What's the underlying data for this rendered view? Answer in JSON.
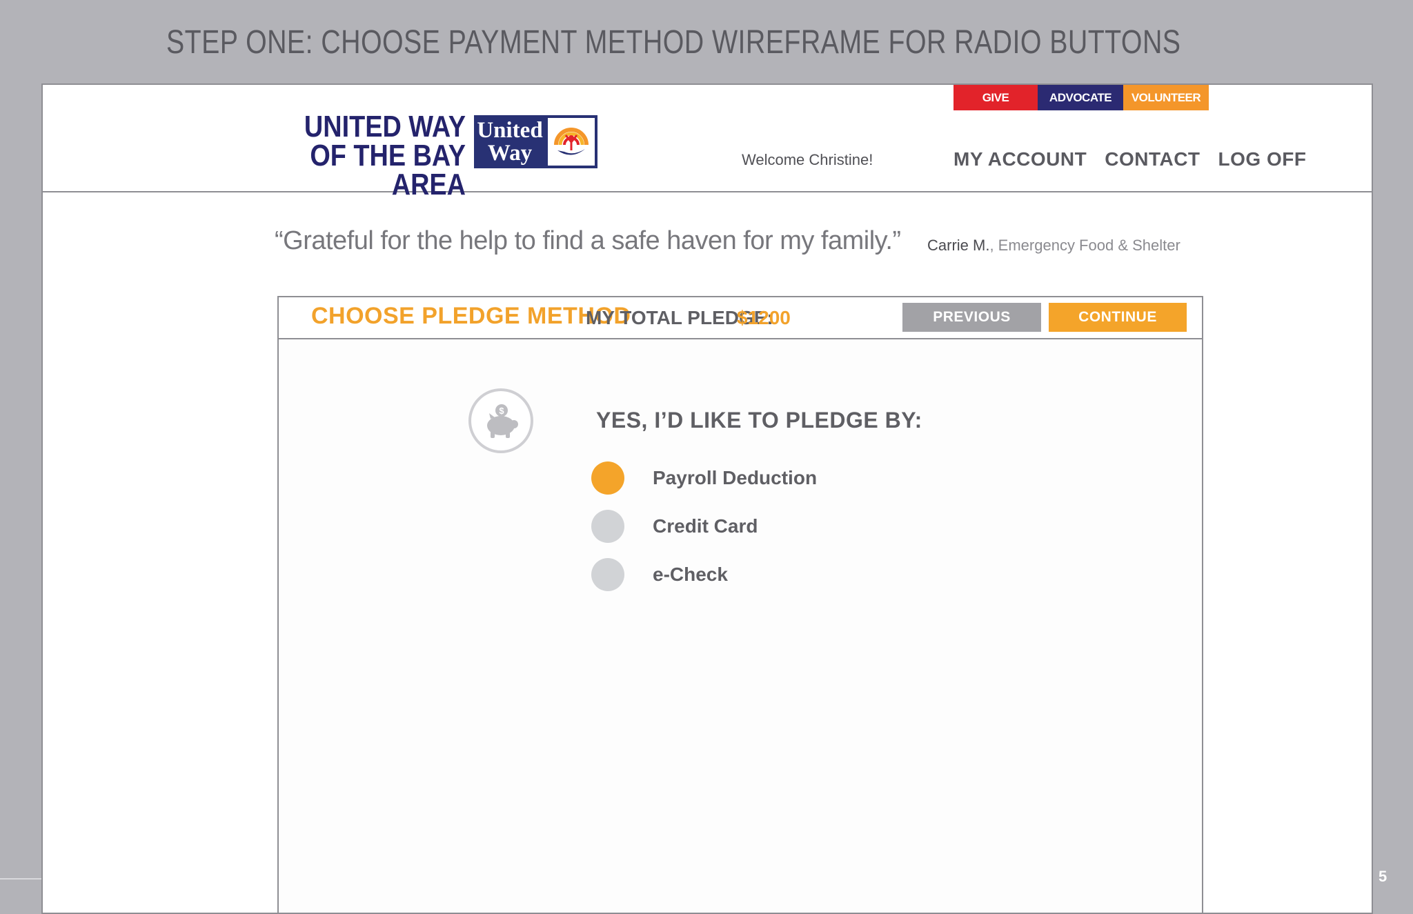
{
  "slide": {
    "title": "STEP ONE:  CHOOSE PAYMENT METHOD WIREFRAME FOR RADIO BUTTONS",
    "page_number": "5"
  },
  "header": {
    "logo_text_line1": "UNITED WAY",
    "logo_text_line2": "OF THE BAY AREA",
    "logo_box_line1": "United",
    "logo_box_line2": "Way",
    "top_tabs": [
      {
        "label": "GIVE",
        "color": "#e2232a"
      },
      {
        "label": "ADVOCATE",
        "color": "#2b2a72"
      },
      {
        "label": "VOLUNTEER",
        "color": "#f4962a"
      }
    ],
    "welcome": "Welcome  Christine!",
    "nav": {
      "my_account": "MY ACCOUNT",
      "contact": "CONTACT",
      "log_off": "LOG OFF"
    }
  },
  "testimonial": {
    "quote": "“Grateful for the help to find a safe haven for my family.”",
    "name": "Carrie M.",
    "program": ", Emergency Food & Shelter"
  },
  "panel": {
    "title": "CHOOSE PLEDGE METHOD",
    "total_label": "MY TOTAL PLEDGE:",
    "total_amount": "$1200",
    "previous_label": "PREVIOUS",
    "continue_label": "CONTINUE",
    "heading": "YES, I’D LIKE TO PLEDGE BY:",
    "options": [
      {
        "label": "Payroll Deduction",
        "selected": true
      },
      {
        "label": "Credit Card",
        "selected": false
      },
      {
        "label": "e-Check",
        "selected": false
      }
    ]
  },
  "colors": {
    "accent_orange": "#f4a42a",
    "brand_navy": "#283174",
    "button_gray": "#a2a2a6",
    "radio_unselected": "#d1d3d6"
  }
}
